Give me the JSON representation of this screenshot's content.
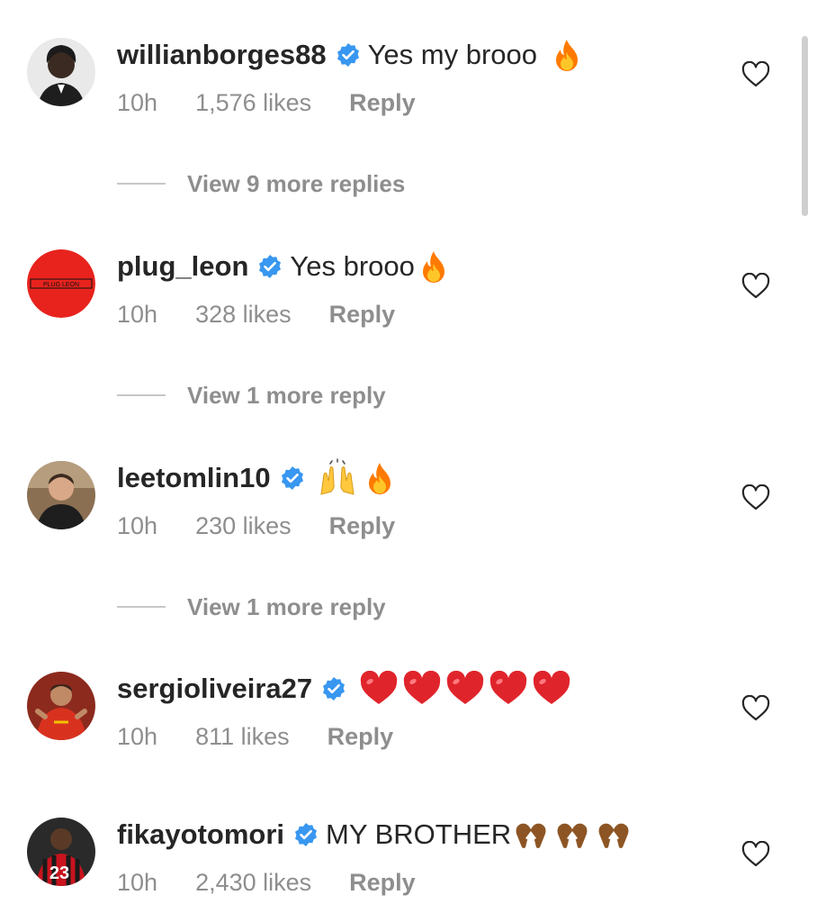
{
  "colors": {
    "text": "#262626",
    "secondary": "#8e8e8e",
    "verified": "#3897f0",
    "heart_emoji": "#e0242b",
    "fire_emoji": "#ff7a00"
  },
  "comments": [
    {
      "username": "willianborges88",
      "verified": true,
      "text": "Yes my brooo",
      "emojis": [
        "fire-emoji"
      ],
      "time": "10h",
      "likes": "1,576 likes",
      "reply_label": "Reply",
      "view_more": "View 9 more replies"
    },
    {
      "username": "plug_leon",
      "verified": true,
      "text": "Yes brooo",
      "emojis": [
        "fire-emoji"
      ],
      "time": "10h",
      "likes": "328 likes",
      "reply_label": "Reply",
      "view_more": "View 1 more reply",
      "avatar_logo_text": "PLUG LEON"
    },
    {
      "username": "leetomlin10",
      "verified": true,
      "text": "",
      "emojis": [
        "raising-hands-emoji",
        "fire-emoji"
      ],
      "time": "10h",
      "likes": "230 likes",
      "reply_label": "Reply",
      "view_more": "View 1 more reply"
    },
    {
      "username": "sergioliveira27",
      "verified": true,
      "text": "",
      "emojis": [
        "red-heart-emoji",
        "red-heart-emoji",
        "red-heart-emoji",
        "red-heart-emoji",
        "red-heart-emoji"
      ],
      "time": "10h",
      "likes": "811 likes",
      "reply_label": "Reply"
    },
    {
      "username": "fikayotomori",
      "verified": true,
      "text": "MY BROTHER",
      "emojis": [
        "heart-hands-emoji",
        "heart-hands-emoji",
        "heart-hands-emoji"
      ],
      "time": "10h",
      "likes": "2,430 likes",
      "reply_label": "Reply"
    }
  ]
}
